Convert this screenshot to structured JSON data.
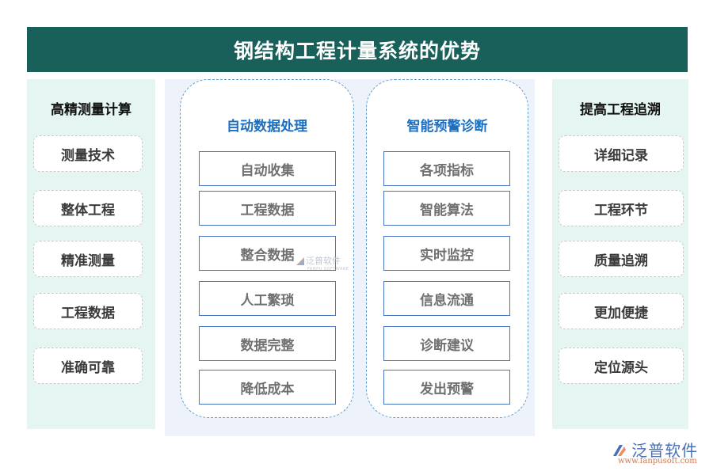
{
  "title": "钢结构工程计量系统的优势",
  "left_panel": {
    "title": "高精测量计算",
    "items": [
      "测量技术",
      "整体工程",
      "精准测量",
      "工程数据",
      "准确可靠"
    ]
  },
  "group1": {
    "title": "自动数据处理",
    "items": [
      "自动收集",
      "工程数据",
      "整合数据",
      "人工繁琐",
      "数据完整",
      "降低成本"
    ]
  },
  "group2": {
    "title": "智能预警诊断",
    "items": [
      "各项指标",
      "智能算法",
      "实时监控",
      "信息流通",
      "诊断建议",
      "发出预警"
    ]
  },
  "right_panel": {
    "title": "提高工程追溯",
    "items": [
      "详细记录",
      "工程环节",
      "质量追溯",
      "更加便捷",
      "定位源头"
    ]
  },
  "watermark": {
    "name": "泛普软件",
    "sub": "FANPU SOFTWARE"
  },
  "brand": {
    "name": "泛普软件",
    "url": "www.fanpusoft.com"
  },
  "colors": {
    "title_bg": "#19605a",
    "side_bg": "#e5f5f2",
    "group_title": "#1c6fbe",
    "box_border": "#4a78c4"
  }
}
